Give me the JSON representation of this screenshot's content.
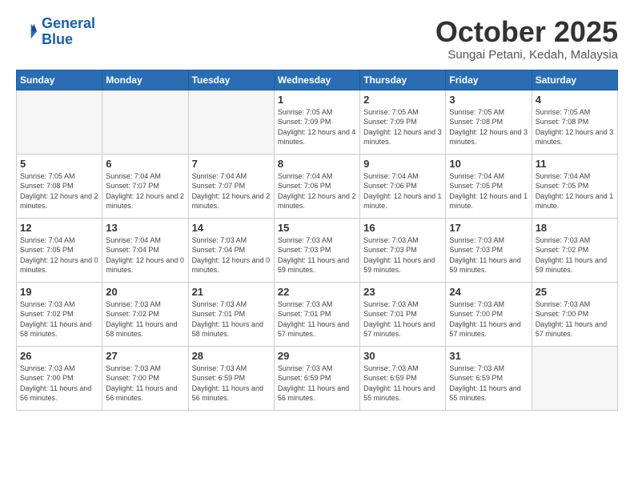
{
  "header": {
    "logo_line1": "General",
    "logo_line2": "Blue",
    "month_title": "October 2025",
    "subtitle": "Sungai Petani, Kedah, Malaysia"
  },
  "days_of_week": [
    "Sunday",
    "Monday",
    "Tuesday",
    "Wednesday",
    "Thursday",
    "Friday",
    "Saturday"
  ],
  "weeks": [
    [
      {
        "day": "",
        "info": ""
      },
      {
        "day": "",
        "info": ""
      },
      {
        "day": "",
        "info": ""
      },
      {
        "day": "1",
        "info": "Sunrise: 7:05 AM\nSunset: 7:09 PM\nDaylight: 12 hours\nand 4 minutes."
      },
      {
        "day": "2",
        "info": "Sunrise: 7:05 AM\nSunset: 7:09 PM\nDaylight: 12 hours\nand 3 minutes."
      },
      {
        "day": "3",
        "info": "Sunrise: 7:05 AM\nSunset: 7:08 PM\nDaylight: 12 hours\nand 3 minutes."
      },
      {
        "day": "4",
        "info": "Sunrise: 7:05 AM\nSunset: 7:08 PM\nDaylight: 12 hours\nand 3 minutes."
      }
    ],
    [
      {
        "day": "5",
        "info": "Sunrise: 7:05 AM\nSunset: 7:08 PM\nDaylight: 12 hours\nand 2 minutes."
      },
      {
        "day": "6",
        "info": "Sunrise: 7:04 AM\nSunset: 7:07 PM\nDaylight: 12 hours\nand 2 minutes."
      },
      {
        "day": "7",
        "info": "Sunrise: 7:04 AM\nSunset: 7:07 PM\nDaylight: 12 hours\nand 2 minutes."
      },
      {
        "day": "8",
        "info": "Sunrise: 7:04 AM\nSunset: 7:06 PM\nDaylight: 12 hours\nand 2 minutes."
      },
      {
        "day": "9",
        "info": "Sunrise: 7:04 AM\nSunset: 7:06 PM\nDaylight: 12 hours\nand 1 minute."
      },
      {
        "day": "10",
        "info": "Sunrise: 7:04 AM\nSunset: 7:05 PM\nDaylight: 12 hours\nand 1 minute."
      },
      {
        "day": "11",
        "info": "Sunrise: 7:04 AM\nSunset: 7:05 PM\nDaylight: 12 hours\nand 1 minute."
      }
    ],
    [
      {
        "day": "12",
        "info": "Sunrise: 7:04 AM\nSunset: 7:05 PM\nDaylight: 12 hours\nand 0 minutes."
      },
      {
        "day": "13",
        "info": "Sunrise: 7:04 AM\nSunset: 7:04 PM\nDaylight: 12 hours\nand 0 minutes."
      },
      {
        "day": "14",
        "info": "Sunrise: 7:03 AM\nSunset: 7:04 PM\nDaylight: 12 hours\nand 0 minutes."
      },
      {
        "day": "15",
        "info": "Sunrise: 7:03 AM\nSunset: 7:03 PM\nDaylight: 11 hours\nand 59 minutes."
      },
      {
        "day": "16",
        "info": "Sunrise: 7:03 AM\nSunset: 7:03 PM\nDaylight: 11 hours\nand 59 minutes."
      },
      {
        "day": "17",
        "info": "Sunrise: 7:03 AM\nSunset: 7:03 PM\nDaylight: 11 hours\nand 59 minutes."
      },
      {
        "day": "18",
        "info": "Sunrise: 7:03 AM\nSunset: 7:02 PM\nDaylight: 11 hours\nand 59 minutes."
      }
    ],
    [
      {
        "day": "19",
        "info": "Sunrise: 7:03 AM\nSunset: 7:02 PM\nDaylight: 11 hours\nand 58 minutes."
      },
      {
        "day": "20",
        "info": "Sunrise: 7:03 AM\nSunset: 7:02 PM\nDaylight: 11 hours\nand 58 minutes."
      },
      {
        "day": "21",
        "info": "Sunrise: 7:03 AM\nSunset: 7:01 PM\nDaylight: 11 hours\nand 58 minutes."
      },
      {
        "day": "22",
        "info": "Sunrise: 7:03 AM\nSunset: 7:01 PM\nDaylight: 11 hours\nand 57 minutes."
      },
      {
        "day": "23",
        "info": "Sunrise: 7:03 AM\nSunset: 7:01 PM\nDaylight: 11 hours\nand 57 minutes."
      },
      {
        "day": "24",
        "info": "Sunrise: 7:03 AM\nSunset: 7:00 PM\nDaylight: 11 hours\nand 57 minutes."
      },
      {
        "day": "25",
        "info": "Sunrise: 7:03 AM\nSunset: 7:00 PM\nDaylight: 11 hours\nand 57 minutes."
      }
    ],
    [
      {
        "day": "26",
        "info": "Sunrise: 7:03 AM\nSunset: 7:00 PM\nDaylight: 11 hours\nand 56 minutes."
      },
      {
        "day": "27",
        "info": "Sunrise: 7:03 AM\nSunset: 7:00 PM\nDaylight: 11 hours\nand 56 minutes."
      },
      {
        "day": "28",
        "info": "Sunrise: 7:03 AM\nSunset: 6:59 PM\nDaylight: 11 hours\nand 56 minutes."
      },
      {
        "day": "29",
        "info": "Sunrise: 7:03 AM\nSunset: 6:59 PM\nDaylight: 11 hours\nand 56 minutes."
      },
      {
        "day": "30",
        "info": "Sunrise: 7:03 AM\nSunset: 6:59 PM\nDaylight: 11 hours\nand 55 minutes."
      },
      {
        "day": "31",
        "info": "Sunrise: 7:03 AM\nSunset: 6:59 PM\nDaylight: 11 hours\nand 55 minutes."
      },
      {
        "day": "",
        "info": ""
      }
    ]
  ]
}
